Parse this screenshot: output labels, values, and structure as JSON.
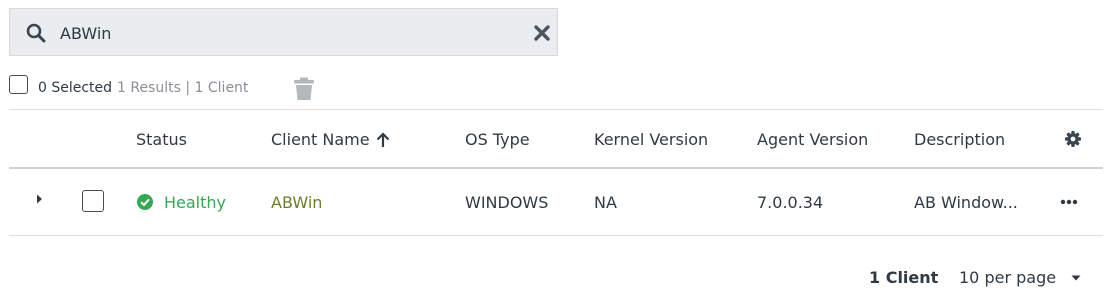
{
  "search": {
    "value": "ABWin",
    "placeholder": ""
  },
  "toolbar": {
    "selected": "0 Selected",
    "results": "1 Results | 1 Client"
  },
  "table": {
    "headers": {
      "status": "Status",
      "client_name": "Client Name",
      "os_type": "OS Type",
      "kernel_version": "Kernel Version",
      "agent_version": "Agent Version",
      "description": "Description"
    },
    "rows": [
      {
        "status": "Healthy",
        "client_name": "ABWin",
        "os_type": "WINDOWS",
        "kernel_version": "NA",
        "agent_version": "7.0.0.34",
        "description": "AB Window..."
      }
    ]
  },
  "footer": {
    "count": "1 Client",
    "per_page": "10 per page"
  },
  "colors": {
    "healthy": "#34a853",
    "client_link": "#6b7f2a",
    "search_bg": "#e9edf0"
  },
  "icons": [
    "search-icon",
    "clear-icon",
    "trash-icon",
    "sort-arrow-up-icon",
    "gear-icon",
    "expand-caret-icon",
    "check-circle-icon",
    "more-options-icon",
    "chevron-down-icon"
  ]
}
